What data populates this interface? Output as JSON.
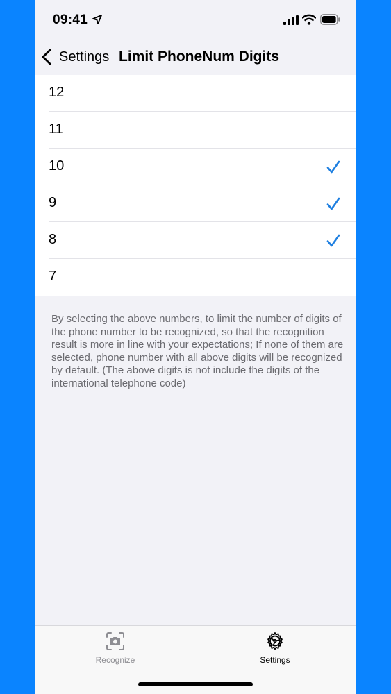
{
  "status_bar": {
    "time": "09:41",
    "icons": [
      "location-arrow-icon",
      "cellular-signal-icon",
      "wifi-icon",
      "battery-icon"
    ]
  },
  "nav": {
    "back_label": "Settings",
    "title": "Limit PhoneNum Digits"
  },
  "digits": [
    {
      "label": "12",
      "checked": false
    },
    {
      "label": "11",
      "checked": false
    },
    {
      "label": "10",
      "checked": true
    },
    {
      "label": "9",
      "checked": true
    },
    {
      "label": "8",
      "checked": true
    },
    {
      "label": "7",
      "checked": false
    }
  ],
  "footer_note": "By selecting the above numbers, to limit the number of digits of the phone number to be recognized, so that the recognition result is more in line with your expectations; If none of them are selected, phone number with all above digits will be recognized by default. (The above digits is not include the digits of the international telephone code)",
  "tabs": [
    {
      "label": "Recognize",
      "icon": "camera-scan-icon",
      "active": false
    },
    {
      "label": "Settings",
      "icon": "gear-icon",
      "active": true
    }
  ],
  "colors": {
    "accent": "#1e7fe0",
    "background": "#f2f2f7",
    "frame": "#0a84ff",
    "inactive_tab": "#8e8e93"
  }
}
